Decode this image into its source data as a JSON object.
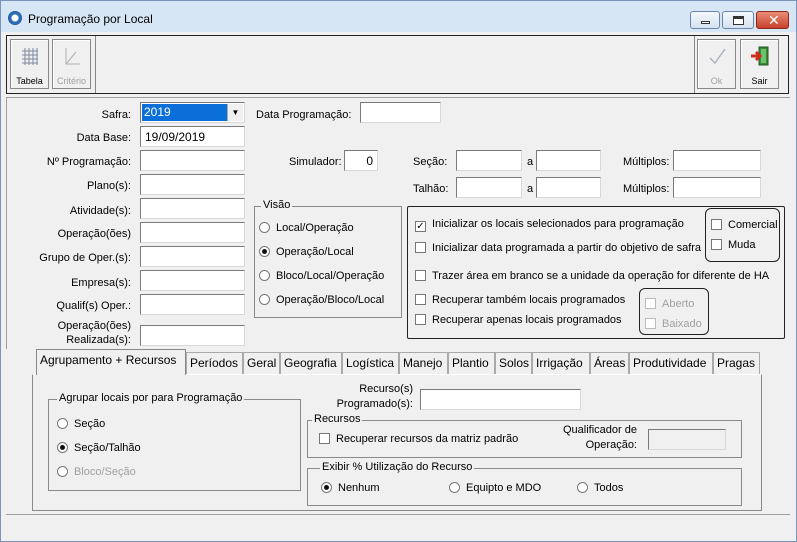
{
  "window": {
    "title": "Programação por Local",
    "close_glyph": "✕"
  },
  "toolbar": {
    "tabela": "Tabela",
    "criterio": "Critério",
    "ok": "Ok",
    "sair": "Sair"
  },
  "form": {
    "safra_label": "Safra:",
    "safra_value": "2019",
    "data_base_label": "Data Base:",
    "data_base_value": "19/09/2019",
    "data_prog_label": "Data Programação:",
    "data_prog_value": "",
    "num_prog_label": "Nº Programação:",
    "plano_label": "Plano(s):",
    "atividade_label": "Atividade(s):",
    "operacao_label": "Operação(ões)",
    "grupo_label": "Grupo de Oper.(s):",
    "empresa_label": "Empresa(s):",
    "qualif_label": "Qualif(s) Oper.:",
    "realizada_label_1": "Operação(ões)",
    "realizada_label_2": "Realizada(s):",
    "simulador_label": "Simulador:",
    "simulador_value": "0",
    "secao_label": "Seção:",
    "talhao_label": "Talhão:",
    "a_label": "a",
    "multiplos_label": "Múltiplos:"
  },
  "visao": {
    "title": "Visão",
    "options": [
      "Local/Operação",
      "Operação/Local",
      "Bloco/Local/Operação",
      "Operação/Bloco/Local"
    ],
    "selected_index": 1
  },
  "options": {
    "inicializar_locais": "Inicializar os locais selecionados para programação",
    "inicializar_data": "Inicializar data programada a partir do objetivo de safra",
    "trazer_area": "Trazer área em branco se a unidade da operação for diferente de HA",
    "recuperar_tambem": "Recuperar também locais programados",
    "recuperar_apenas": "Recuperar apenas locais programados",
    "comercial": "Comercial",
    "muda": "Muda",
    "aberto": "Aberto",
    "baixado": "Baixado",
    "check_mark": "✓"
  },
  "tabs": [
    "Agrupamento + Recursos",
    "Períodos",
    "Geral",
    "Geografia",
    "Logística",
    "Manejo",
    "Plantio",
    "Solos",
    "Irrigação",
    "Áreas",
    "Produtividade",
    "Pragas"
  ],
  "tab_agrupamento": {
    "agrupar_title": "Agrupar locais por para Programação",
    "agrupar_options": [
      "Seção",
      "Seção/Talhão",
      "Bloco/Seção"
    ],
    "agrupar_selected": 1,
    "recursos_prog_label_1": "Recurso(s)",
    "recursos_prog_label_2": "Programado(s):",
    "recursos_title": "Recursos",
    "recuperar_matriz": "Recuperar recursos da matriz padrão",
    "qualificador_label_1": "Qualificador de",
    "qualificador_label_2": "Operação:",
    "exibir_title": "Exibir % Utilização do Recurso",
    "exibir_options": [
      "Nenhum",
      "Equipto e MDO",
      "Todos"
    ],
    "exibir_selected": 0
  }
}
